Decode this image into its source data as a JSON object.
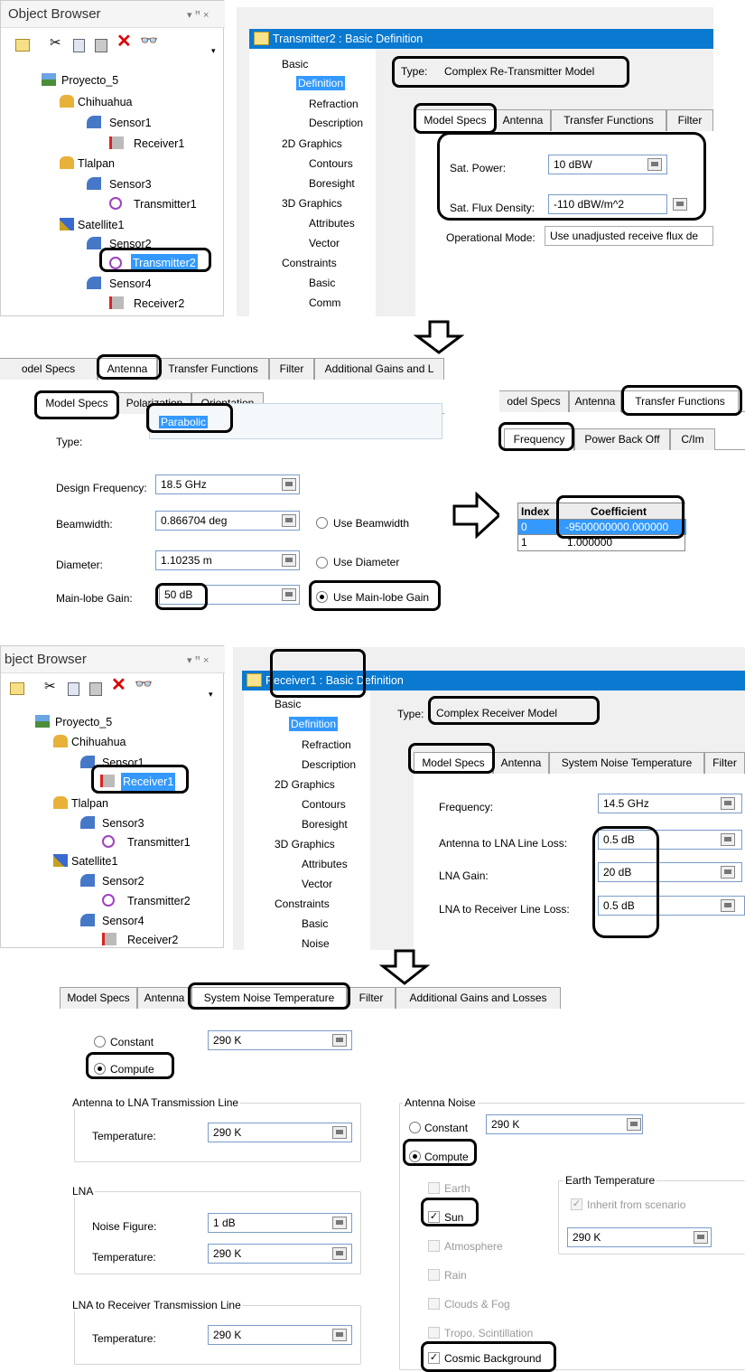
{
  "object_browser_1": {
    "title": "Object Browser",
    "window_controls": "▾ ꟸ ×",
    "tree": [
      {
        "label": "Proyecto_5",
        "icon": "scenario-icon"
      },
      {
        "label": "Chihuahua",
        "icon": "facility-icon"
      },
      {
        "label": "Sensor1",
        "icon": "sensor-icon"
      },
      {
        "label": "Receiver1",
        "icon": "receiver-icon"
      },
      {
        "label": "Tlalpan",
        "icon": "facility-icon"
      },
      {
        "label": "Sensor3",
        "icon": "sensor-icon"
      },
      {
        "label": "Transmitter1",
        "icon": "transmitter-icon"
      },
      {
        "label": "Satellite1",
        "icon": "satellite-icon"
      },
      {
        "label": "Sensor2",
        "icon": "sensor-icon"
      },
      {
        "label": "Transmitter2",
        "icon": "transmitter-icon"
      },
      {
        "label": "Sensor4",
        "icon": "sensor-icon"
      },
      {
        "label": "Receiver2",
        "icon": "receiver-icon"
      }
    ]
  },
  "tx_props": {
    "title": "Transmitter2 : Basic Definition",
    "nav": [
      "Basic",
      "Definition",
      "Refraction",
      "Description",
      "2D Graphics",
      "Contours",
      "Boresight",
      "3D Graphics",
      "Attributes",
      "Vector",
      "Constraints",
      "Basic",
      "Comm"
    ],
    "type_label": "Type:",
    "type_value": "Complex Re-Transmitter Model",
    "tabs": [
      "Model Specs",
      "Antenna",
      "Transfer Functions",
      "Filter"
    ],
    "sat_power_label": "Sat. Power:",
    "sat_power_value": "10 dBW",
    "sat_flux_label": "Sat. Flux Density:",
    "sat_flux_value": "-110 dBW/m^2",
    "op_mode_label": "Operational Mode:",
    "op_mode_value": "Use unadjusted receive flux de"
  },
  "tx_antenna": {
    "tabs": [
      "odel Specs",
      "Antenna",
      "Transfer Functions",
      "Filter",
      "Additional Gains and L"
    ],
    "subtabs": [
      "Model Specs",
      "Polarization",
      "Orientation"
    ],
    "type_label": "Type:",
    "type_value": "Parabolic",
    "design_freq_label": "Design Frequency:",
    "design_freq_value": "18.5 GHz",
    "beamwidth_label": "Beamwidth:",
    "beamwidth_value": "0.866704 deg",
    "use_beamwidth": "Use Beamwidth",
    "diameter_label": "Diameter:",
    "diameter_value": "1.10235 m",
    "use_diameter": "Use Diameter",
    "mainlobe_label": "Main-lobe Gain:",
    "mainlobe_value": "50 dB",
    "use_mainlobe": "Use Main-lobe Gain"
  },
  "tx_transfer": {
    "tabs": [
      "odel Specs",
      "Antenna",
      "Transfer Functions"
    ],
    "subtabs": [
      "Frequency",
      "Power Back Off",
      "C/Im"
    ],
    "columns": [
      "Index",
      "Coefficient"
    ],
    "rows": [
      [
        "0",
        "-9500000000.000000"
      ],
      [
        "1",
        "1.000000"
      ]
    ]
  },
  "object_browser_2": {
    "title": "bject Browser",
    "tree": [
      {
        "label": "Proyecto_5"
      },
      {
        "label": "Chihuahua"
      },
      {
        "label": "Sensor1"
      },
      {
        "label": "Receiver1"
      },
      {
        "label": "Tlalpan"
      },
      {
        "label": "Sensor3"
      },
      {
        "label": "Transmitter1"
      },
      {
        "label": "Satellite1"
      },
      {
        "label": "Sensor2"
      },
      {
        "label": "Transmitter2"
      },
      {
        "label": "Sensor4"
      },
      {
        "label": "Receiver2"
      }
    ]
  },
  "rx_props": {
    "title": "Receiver1 : Basic Definition",
    "nav": [
      "Basic",
      "Definition",
      "Refraction",
      "Description",
      "2D Graphics",
      "Contours",
      "Boresight",
      "3D Graphics",
      "Attributes",
      "Vector",
      "Constraints",
      "Basic",
      "Noise"
    ],
    "type_label": "Type:",
    "type_value": "Complex Receiver Model",
    "tabs": [
      "Model Specs",
      "Antenna",
      "System Noise Temperature",
      "Filter"
    ],
    "freq_label": "Frequency:",
    "freq_value": "14.5 GHz",
    "ant_lna_label": "Antenna to LNA Line Loss:",
    "ant_lna_value": "0.5 dB",
    "lna_gain_label": "LNA Gain:",
    "lna_gain_value": "20 dB",
    "lna_rx_label": "LNA to Receiver Line Loss:",
    "lna_rx_value": "0.5 dB"
  },
  "noise": {
    "tabs": [
      "Model Specs",
      "Antenna",
      "System Noise Temperature",
      "Filter",
      "Additional Gains and Losses"
    ],
    "constant_label": "Constant",
    "constant_value": "290 K",
    "compute_label": "Compute",
    "grp_ant_lna": "Antenna to LNA Transmission Line",
    "temp_label": "Temperature:",
    "temp_value": "290 K",
    "grp_lna": "LNA",
    "nf_label": "Noise Figure:",
    "nf_value": "1 dB",
    "grp_lna_rx": "LNA to Receiver Transmission Line",
    "grp_ant_noise": "Antenna Noise",
    "an_constant": "Constant",
    "an_constant_value": "290 K",
    "an_compute": "Compute",
    "sources": [
      "Earth",
      "Sun",
      "Atmosphere",
      "Rain",
      "Clouds & Fog",
      "Tropo. Scintillation",
      "Cosmic Background"
    ],
    "grp_earth": "Earth Temperature",
    "inherit": "Inherit from scenario",
    "earth_value": "290 K"
  }
}
